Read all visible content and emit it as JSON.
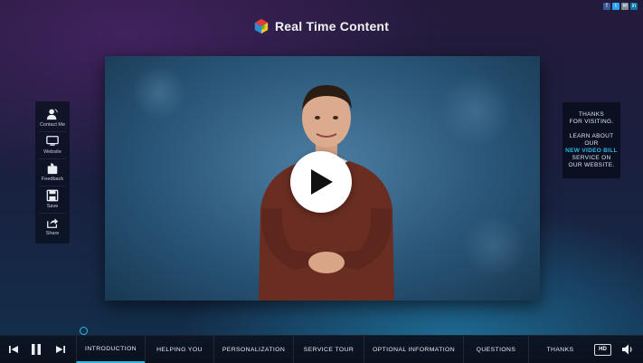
{
  "brand": {
    "name": "Real Time Content"
  },
  "social": [
    {
      "icon": "facebook-icon",
      "label": "f",
      "color": "#3b5998"
    },
    {
      "icon": "twitter-icon",
      "label": "t",
      "color": "#2aa3ef"
    },
    {
      "icon": "email-icon",
      "label": "✉",
      "color": "#7d8a99"
    },
    {
      "icon": "linkedin-icon",
      "label": "in",
      "color": "#0e76a8"
    }
  ],
  "sidebar": {
    "items": [
      {
        "label": "Contact Me",
        "icon": "contact-icon"
      },
      {
        "label": "Website",
        "icon": "monitor-icon"
      },
      {
        "label": "Feedback",
        "icon": "feedback-icon"
      },
      {
        "label": "Save",
        "icon": "save-icon"
      },
      {
        "label": "Share",
        "icon": "share-icon"
      }
    ]
  },
  "promo": {
    "line1": "THANKS",
    "line2": "FOR VISITING.",
    "line3": "LEARN ABOUT OUR",
    "highlight": "NEW VIDEO BILL",
    "line4": "SERVICE ON",
    "line5": "OUR WEBSITE."
  },
  "player": {
    "chapters": [
      "INTRODUCTION",
      "HELPING YOU",
      "PERSONALIZATION",
      "SERVICE TOUR",
      "OPTIONAL INFORMATION",
      "QUESTIONS",
      "THANKS"
    ],
    "hd_label": "HD",
    "accent": "#2fb6e6"
  }
}
